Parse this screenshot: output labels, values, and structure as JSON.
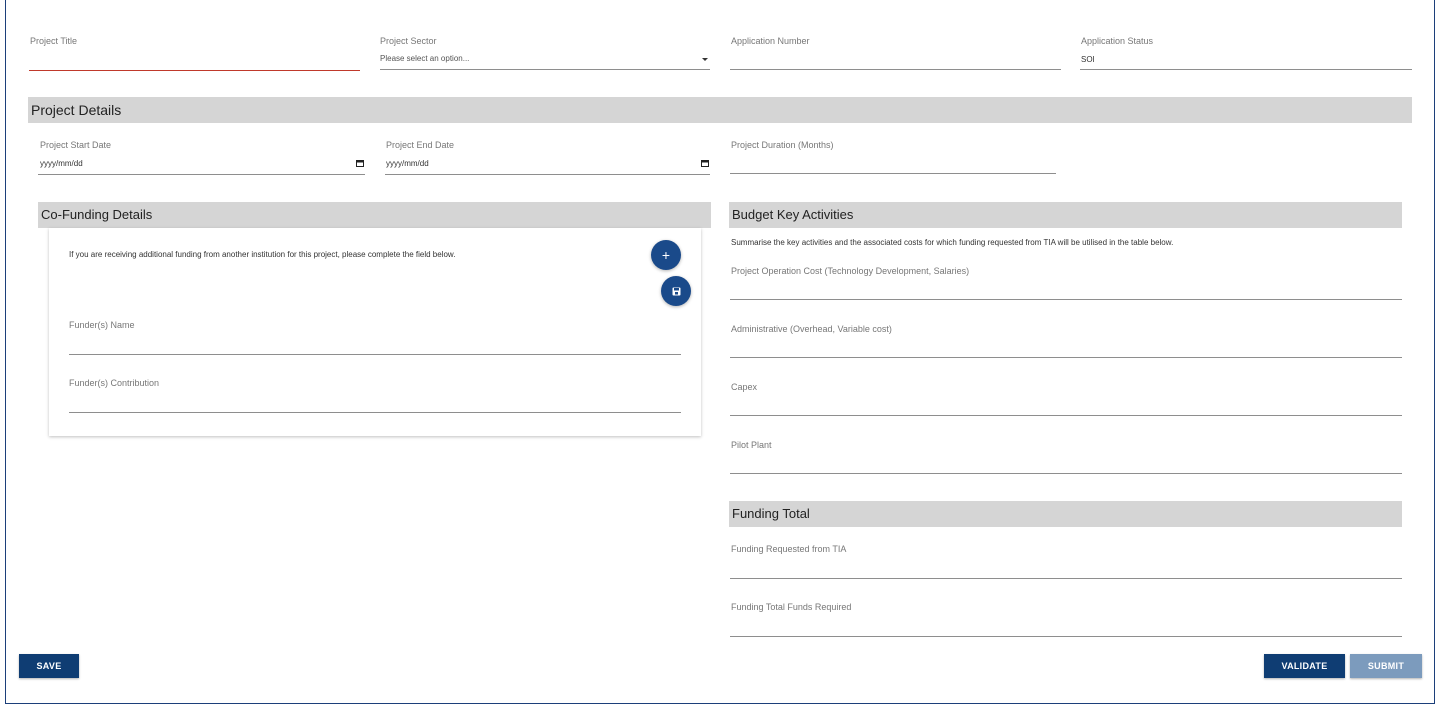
{
  "top_fields": {
    "project_title": {
      "label": "Project Title",
      "value": ""
    },
    "project_sector": {
      "label": "Project Sector",
      "placeholder": "Please select an option..."
    },
    "application_number": {
      "label": "Application Number",
      "value": ""
    },
    "application_status": {
      "label": "Application Status",
      "value": "SOI"
    }
  },
  "project_details": {
    "heading": "Project Details",
    "start_date": {
      "label": "Project Start Date",
      "placeholder": "yyyy/mm/dd"
    },
    "end_date": {
      "label": "Project End Date",
      "placeholder": "yyyy/mm/dd"
    },
    "duration": {
      "label": "Project Duration (Months)",
      "value": ""
    }
  },
  "co_funding": {
    "heading": "Co-Funding Details",
    "helper": "If you are receiving additional funding from another institution for this project, please complete the field below.",
    "add_glyph": "+",
    "funder_name": {
      "label": "Funder(s) Name",
      "value": ""
    },
    "funder_contribution": {
      "label": "Funder(s) Contribution",
      "value": ""
    }
  },
  "budget": {
    "heading": "Budget Key Activities",
    "helper": "Summarise the key activities and the associated costs for which funding requested from TIA will be utilised in the table below.",
    "operation_cost": {
      "label": "Project Operation Cost (Technology Development, Salaries)"
    },
    "administrative": {
      "label": "Administrative (Overhead, Variable cost)"
    },
    "capex": {
      "label": "Capex"
    },
    "pilot_plant": {
      "label": "Pilot Plant"
    }
  },
  "funding_total": {
    "heading": "Funding Total",
    "requested_from_tia": {
      "label": "Funding Requested from TIA"
    },
    "total_funds_required": {
      "label": "Funding Total Funds Required"
    }
  },
  "actions": {
    "save": "SAVE",
    "validate": "VALIDATE",
    "submit": "SUBMIT"
  },
  "colors": {
    "primary": "#0f3d73",
    "fab": "#1a4a8a",
    "disabled": "#7c9bbd",
    "section_bar": "#d5d5d5",
    "error_underline": "#c0392b"
  },
  "icons": {
    "calendar": "calendar-icon",
    "dropdown": "chevron-down-icon",
    "add": "plus-icon",
    "save": "floppy-disk-icon"
  }
}
